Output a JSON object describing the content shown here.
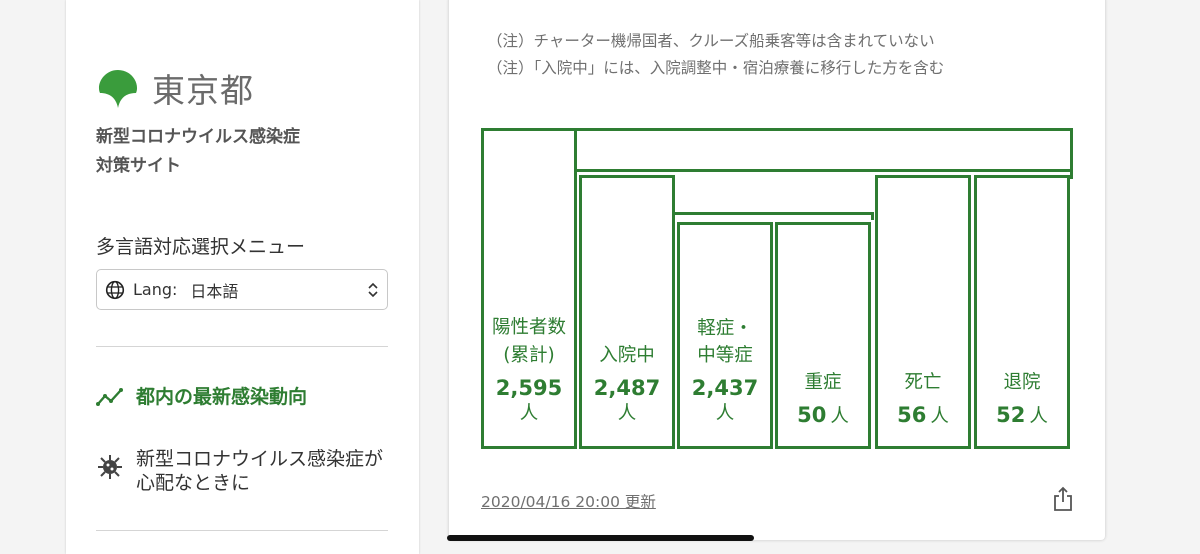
{
  "sidebar": {
    "logo_text": "東京都",
    "site_title_line1": "新型コロナウイルス感染症",
    "site_title_line2": "対策サイト",
    "lang_heading": "多言語対応選択メニュー",
    "lang_label": "Lang:",
    "lang_value": "日本語",
    "nav": [
      {
        "label": "都内の最新感染動向",
        "icon": "trend-line-icon",
        "active": true
      },
      {
        "label": "新型コロナウイルス感染症が心配なときに",
        "icon": "virus-icon",
        "active": false
      }
    ]
  },
  "main": {
    "notes": [
      "（注）チャーター機帰国者、クルーズ船乗客等は含まれていない",
      "（注）「入院中」には、入院調整中・宿泊療養に移行した方を含む"
    ],
    "chart_data": {
      "type": "table",
      "unit": "人",
      "cells": [
        {
          "label_line1": "陽性者数",
          "label_line2": "(累計)",
          "value": "2,595"
        },
        {
          "label_line1": "入院中",
          "label_line2": "",
          "value": "2,487"
        },
        {
          "label_line1": "軽症・",
          "label_line2": "中等症",
          "value": "2,437"
        },
        {
          "label_line1": "重症",
          "label_line2": "",
          "value": "50"
        },
        {
          "label_line1": "死亡",
          "label_line2": "",
          "value": "56"
        },
        {
          "label_line1": "退院",
          "label_line2": "",
          "value": "52"
        }
      ]
    },
    "updated": "2020/04/16 20:00 更新"
  },
  "colors": {
    "accent": "#2e7d32",
    "logo_green": "#3a9c3c"
  }
}
